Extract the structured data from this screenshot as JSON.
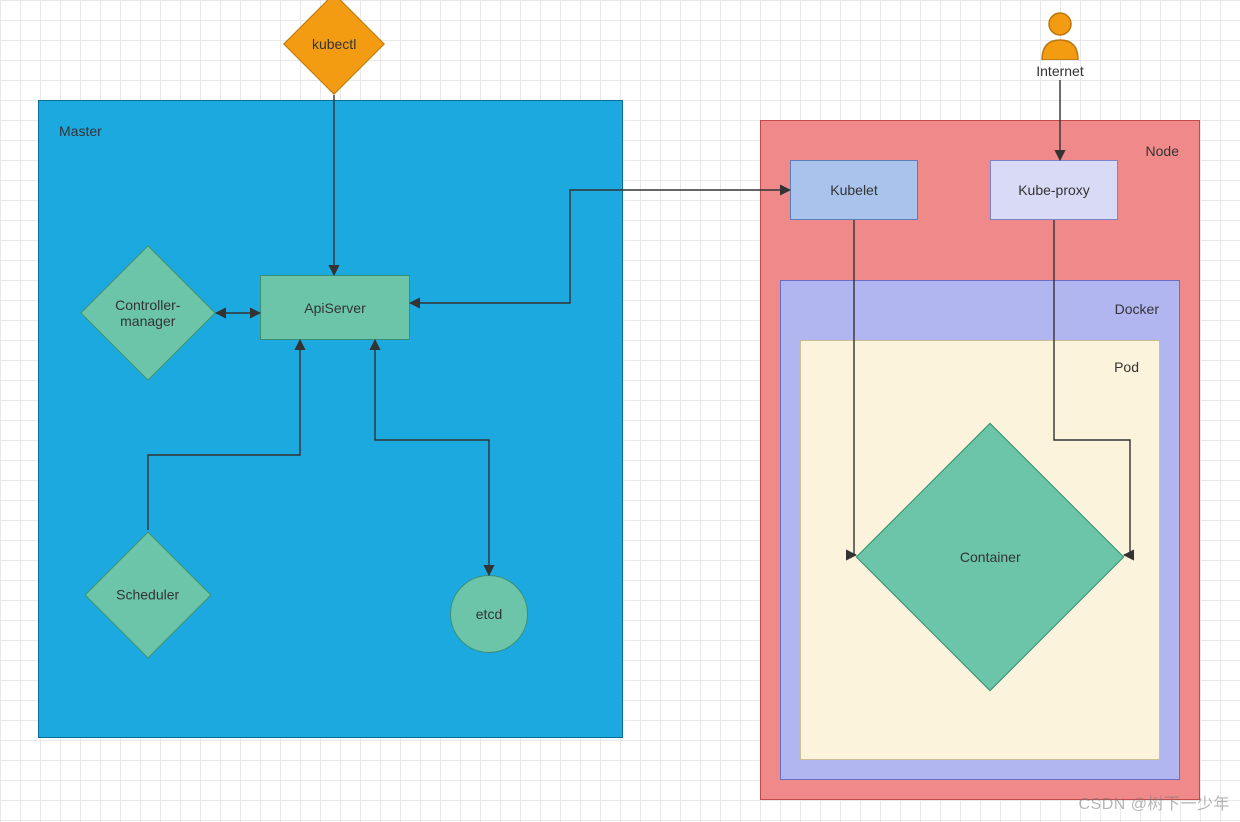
{
  "master": {
    "title": "Master"
  },
  "node": {
    "title": "Node"
  },
  "docker": {
    "title": "Docker"
  },
  "pod": {
    "title": "Pod"
  },
  "shapes": {
    "kubectl": "kubectl",
    "controller_manager": "Controller-\nmanager",
    "apiserver": "ApiServer",
    "scheduler": "Scheduler",
    "etcd": "etcd",
    "kubelet": "Kubelet",
    "kube_proxy": "Kube-proxy",
    "container": "Container",
    "internet": "Internet"
  },
  "watermark": "CSDN @树下一少年",
  "colors": {
    "master_fill": "#1CA9E0",
    "master_stroke": "#0B6E99",
    "node_fill": "#F08A8A",
    "node_stroke": "#C24A4A",
    "docker_fill": "#B2B6F0",
    "docker_stroke": "#6A6EC7",
    "pod_fill": "#FBF3DC",
    "pod_stroke": "#CDBF94",
    "teal_fill": "#6CC5A9",
    "teal_stroke": "#3A8F73",
    "orange_fill": "#F39C12",
    "orange_stroke": "#B9770E",
    "blue_fill": "#A9C3EC",
    "blue_stroke": "#5C7DB8",
    "lavender_fill": "#D9DBF6",
    "lavender_stroke": "#7E82C9"
  }
}
